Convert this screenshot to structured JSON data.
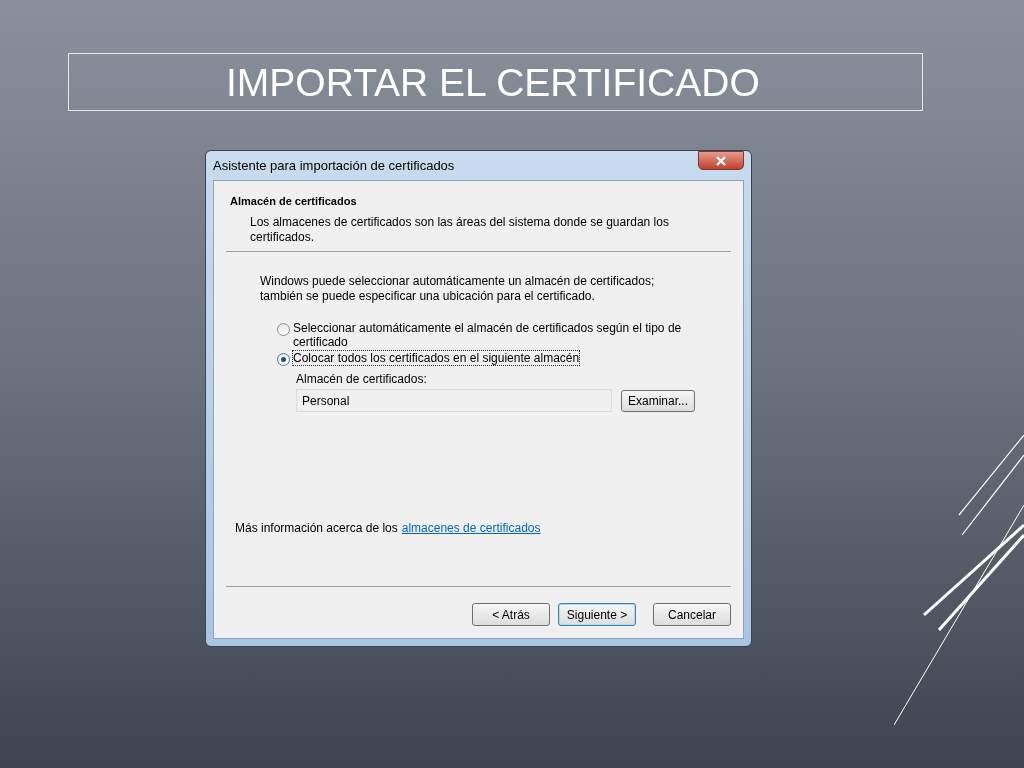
{
  "slide": {
    "title": "IMPORTAR EL CERTIFICADO"
  },
  "dialog": {
    "title": "Asistente para importación de certificados",
    "heading": "Almacén de certificados",
    "description": "Los almacenes de certificados son las áreas del sistema donde se guardan los certificados.",
    "intro": "Windows puede seleccionar automáticamente un almacén de certificados; también se puede especificar una ubicación para el certificado.",
    "options": [
      {
        "label": "Seleccionar automáticamente el almacén de certificados según el tipo de certificado",
        "selected": false
      },
      {
        "label": "Colocar todos los certificados en el siguiente almacén",
        "selected": true
      }
    ],
    "store_label": "Almacén de certificados:",
    "store_value": "Personal",
    "browse_button": "Examinar...",
    "info_text": "Más información acerca de los",
    "info_link": "almacenes de certificados",
    "buttons": [
      {
        "label": "< Atrás",
        "kind": "normal"
      },
      {
        "label": "Siguiente >",
        "kind": "default"
      },
      {
        "label": "Cancelar",
        "kind": "normal"
      }
    ]
  }
}
